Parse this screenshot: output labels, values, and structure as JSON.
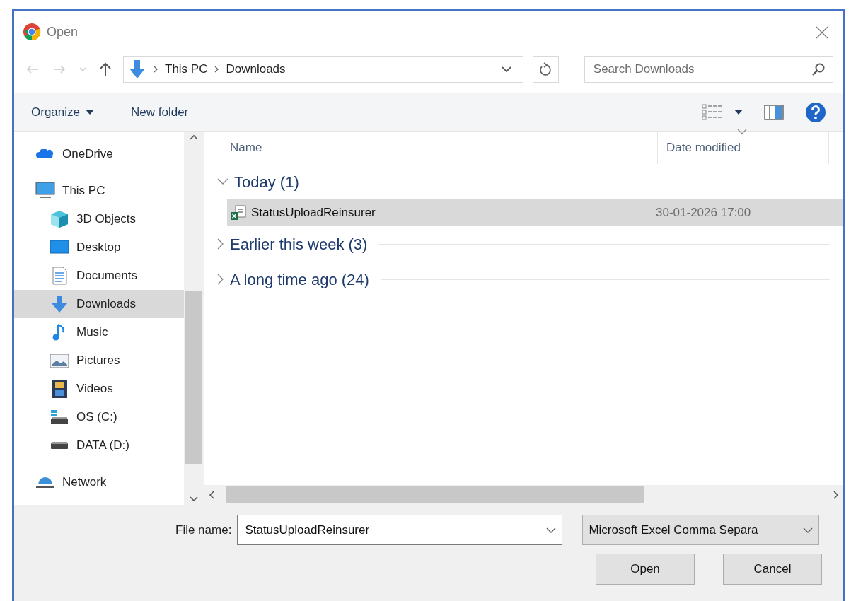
{
  "window": {
    "title": "Open"
  },
  "address": {
    "crumbs": [
      "This PC",
      "Downloads"
    ]
  },
  "search": {
    "placeholder": "Search Downloads"
  },
  "toolbar": {
    "organize": "Organize",
    "new_folder": "New folder"
  },
  "sidebar": {
    "items": [
      {
        "label": "OneDrive",
        "kind": "cloud",
        "selected": false
      },
      {
        "label": "This PC",
        "kind": "pc",
        "selected": false,
        "children": [
          {
            "label": "3D Objects",
            "kind": "cube",
            "selected": false
          },
          {
            "label": "Desktop",
            "kind": "desktop",
            "selected": false
          },
          {
            "label": "Documents",
            "kind": "documents",
            "selected": false
          },
          {
            "label": "Downloads",
            "kind": "downloads",
            "selected": true
          },
          {
            "label": "Music",
            "kind": "music",
            "selected": false
          },
          {
            "label": "Pictures",
            "kind": "pictures",
            "selected": false
          },
          {
            "label": "Videos",
            "kind": "videos",
            "selected": false
          },
          {
            "label": "OS (C:)",
            "kind": "osdrive",
            "selected": false
          },
          {
            "label": "DATA (D:)",
            "kind": "drive",
            "selected": false
          }
        ]
      },
      {
        "label": "Network",
        "kind": "network",
        "selected": false
      }
    ]
  },
  "columns": [
    {
      "label": "Name",
      "sorted": false
    },
    {
      "label": "Date modified",
      "sorted": true
    }
  ],
  "groups": [
    {
      "label": "Today (1)",
      "expanded": true,
      "files": [
        {
          "name": "StatusUploadReinsurer",
          "date": "30-01-2026 17:00",
          "selected": true
        }
      ]
    },
    {
      "label": "Earlier this week (3)",
      "expanded": false
    },
    {
      "label": "A long time ago (24)",
      "expanded": false
    }
  ],
  "file_name": {
    "label": "File name:",
    "value": "StatusUploadReinsurer"
  },
  "file_type": {
    "value": "Microsoft Excel Comma Separa"
  },
  "buttons": [
    "Open",
    "Cancel"
  ]
}
